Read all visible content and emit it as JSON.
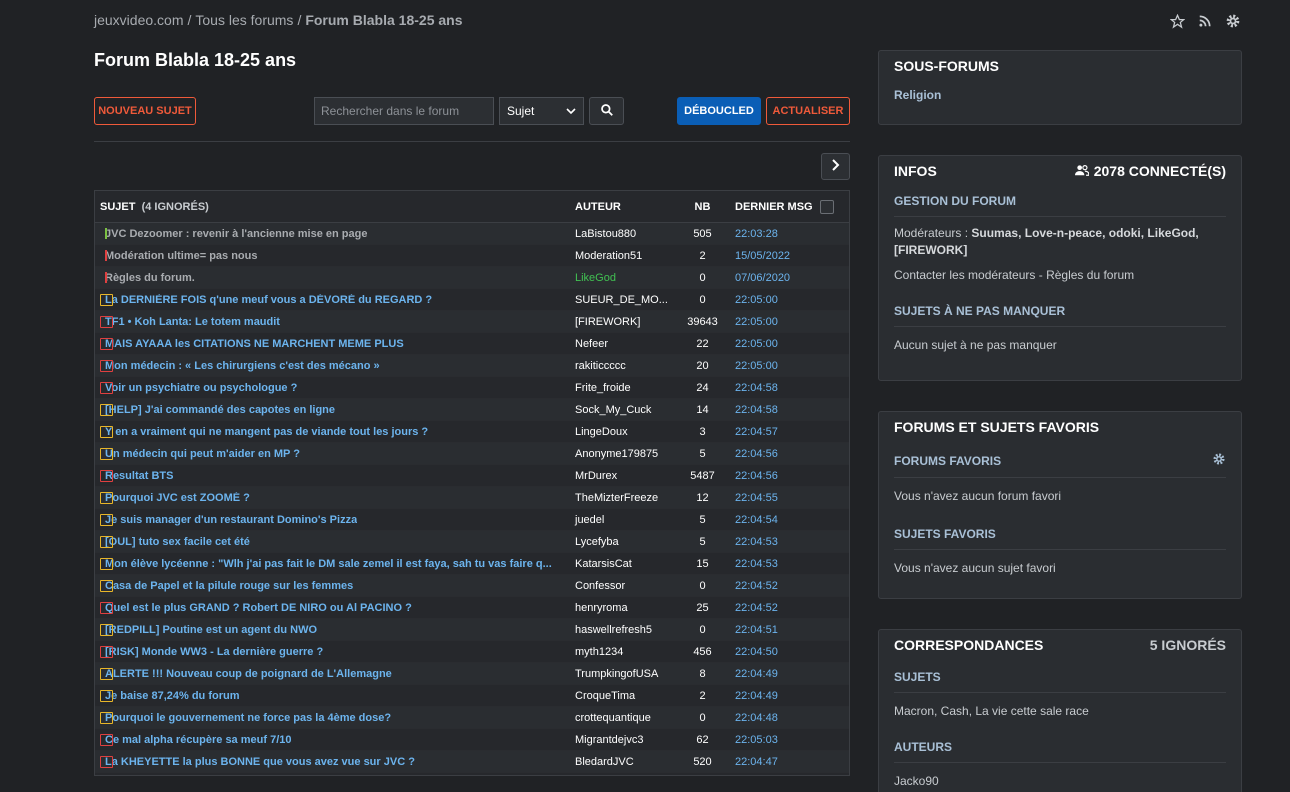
{
  "breadcrumb": {
    "site": "jeuxvideo.com",
    "sep1": "/",
    "forums": "Tous les forums",
    "sep2": "/",
    "current": "Forum Blabla 18-25 ans"
  },
  "page_title": "Forum Blabla 18-25 ans",
  "toolbar": {
    "new_topic": "NOUVEAU SUJET",
    "search_placeholder": "Rechercher dans le forum",
    "select_value": "Sujet",
    "deboucled": "DÉBOUCLED",
    "refresh": "ACTUALISER"
  },
  "table": {
    "headers": {
      "sujet": "SUJET",
      "ignored": "(4 IGNORÉS)",
      "auteur": "AUTEUR",
      "nb": "NB",
      "dernier": "DERNIER MSG"
    },
    "rows": [
      {
        "icon": "pin-green",
        "title": "JVC Dezoomer : revenir à l'ancienne mise en page",
        "author": "LaBistou880",
        "nb": "505",
        "date": "22:03:28",
        "pinned": true
      },
      {
        "icon": "pin-red",
        "title": "Modération ultime= pas nous",
        "author": "Moderation51",
        "nb": "2",
        "date": "15/05/2022",
        "pinned": true
      },
      {
        "icon": "pin-red",
        "title": "Règles du forum.",
        "author": "LikeGod",
        "nb": "0",
        "date": "07/06/2020",
        "pinned": true,
        "author_green": true
      },
      {
        "icon": "folder",
        "title": "La DERNIÈRE FOIS q'une meuf vous a DÉVORÉ du REGARD ?",
        "author": "SUEUR_DE_MO...",
        "nb": "0",
        "date": "22:05:00"
      },
      {
        "icon": "folder-red",
        "title": "TF1 • Koh Lanta: Le totem maudit",
        "author": "[FIREWORK]",
        "nb": "39643",
        "date": "22:05:00"
      },
      {
        "icon": "folder-red",
        "title": "MAIS AYAAA les CITATIONS NE MARCHENT MEME PLUS",
        "author": "Nefeer",
        "nb": "22",
        "date": "22:05:00"
      },
      {
        "icon": "folder-red",
        "title": "Mon médecin : « Les chirurgiens c'est des mécano »",
        "author": "rakiticcccc",
        "nb": "20",
        "date": "22:05:00"
      },
      {
        "icon": "folder-red",
        "title": "Voir un psychiatre ou psychologue ?",
        "author": "Frite_froide",
        "nb": "24",
        "date": "22:04:58"
      },
      {
        "icon": "folder",
        "title": "[HELP] J'ai commandé des capotes en ligne",
        "author": "Sock_My_Cuck",
        "nb": "14",
        "date": "22:04:58"
      },
      {
        "icon": "folder",
        "title": "Y en a vraiment qui ne mangent pas de viande tout les jours ?",
        "author": "LingeDoux",
        "nb": "3",
        "date": "22:04:57"
      },
      {
        "icon": "folder",
        "title": "Un médecin qui peut m'aider en MP ?",
        "author": "Anonyme179875",
        "nb": "5",
        "date": "22:04:56"
      },
      {
        "icon": "folder-red",
        "title": "Resultat BTS",
        "author": "MrDurex",
        "nb": "5487",
        "date": "22:04:56"
      },
      {
        "icon": "folder",
        "title": "Pourquoi JVC est ZOOMÉ ?",
        "author": "TheMizterFreeze",
        "nb": "12",
        "date": "22:04:55"
      },
      {
        "icon": "folder",
        "title": "Je suis manager d'un restaurant Domino's Pizza",
        "author": "juedel",
        "nb": "5",
        "date": "22:04:54"
      },
      {
        "icon": "folder",
        "title": "[OUL] tuto sex facile cet été",
        "author": "Lycefyba",
        "nb": "5",
        "date": "22:04:53"
      },
      {
        "icon": "folder",
        "title": "Mon élève lycéenne : \"Wlh j'ai pas fait le DM sale zemel il est faya, sah tu vas faire q...",
        "author": "KatarsisCat",
        "nb": "15",
        "date": "22:04:53"
      },
      {
        "icon": "folder",
        "title": "Casa de Papel et la pilule rouge sur les femmes",
        "author": "Confessor",
        "nb": "0",
        "date": "22:04:52"
      },
      {
        "icon": "folder-red",
        "title": "Quel est le plus GRAND ? Robert DE NIRO ou Al PACINO ?",
        "author": "henryroma",
        "nb": "25",
        "date": "22:04:52"
      },
      {
        "icon": "folder",
        "title": "[REDPILL] Poutine est un agent du NWO",
        "author": "haswellrefresh5",
        "nb": "0",
        "date": "22:04:51"
      },
      {
        "icon": "folder-red",
        "title": "[RISK] Monde WW3 - La dernière guerre ?",
        "author": "myth1234",
        "nb": "456",
        "date": "22:04:50"
      },
      {
        "icon": "folder",
        "title": "ALERTE !!! Nouveau coup de poignard de L'Allemagne",
        "author": "TrumpkingofUSA",
        "nb": "8",
        "date": "22:04:49"
      },
      {
        "icon": "folder",
        "title": "Je baise 87,24% du forum",
        "author": "CroqueTima",
        "nb": "2",
        "date": "22:04:49"
      },
      {
        "icon": "folder",
        "title": "Pourquoi le gouvernement ne force pas la 4ème dose?",
        "author": "crottequantique",
        "nb": "0",
        "date": "22:04:48"
      },
      {
        "icon": "folder-red",
        "title": "Ce mal alpha récupère sa meuf 7/10",
        "author": "Migrantdejvc3",
        "nb": "62",
        "date": "22:05:03"
      },
      {
        "icon": "folder-red",
        "title": "La KHEYETTE la plus BONNE que vous avez vue sur JVC ?",
        "author": "BledardJVC",
        "nb": "520",
        "date": "22:04:47"
      }
    ]
  },
  "sidebar": {
    "sous_forums": {
      "title": "SOUS-FORUMS",
      "item": "Religion"
    },
    "infos": {
      "title": "INFOS",
      "connected": "2078 connecté(s)",
      "gestion": "GESTION DU FORUM",
      "mods_label": "Modérateurs :",
      "mods": "Suumas, Love-n-peace, odoki, LikeGod, [FIREWORK]",
      "contact": "Contacter les modérateurs",
      "contact_sep": " - ",
      "rules": "Règles du forum",
      "must_see": "SUJETS À NE PAS MANQUER",
      "must_see_text": "Aucun sujet à ne pas manquer"
    },
    "favoris": {
      "title": "FORUMS ET SUJETS FAVORIS",
      "forums_title": "FORUMS FAVORIS",
      "forums_text": "Vous n'avez aucun forum favori",
      "sujets_title": "SUJETS FAVORIS",
      "sujets_text": "Vous n'avez aucun sujet favori"
    },
    "correspondances": {
      "title": "CORRESPONDANCES",
      "ignored": "5 IGNORÉS",
      "sujets_title": "SUJETS",
      "sujets_text": "Macron,  Cash,  La vie cette sale race",
      "auteurs_title": "AUTEURS",
      "auteurs_text": "Jacko90"
    }
  },
  "colors": {
    "link": "#6cb4ee",
    "accent_orange": "#ef5a3a",
    "accent_blue": "#0a5eb6",
    "folder": "#e8b629",
    "folder_red": "#e04040"
  }
}
